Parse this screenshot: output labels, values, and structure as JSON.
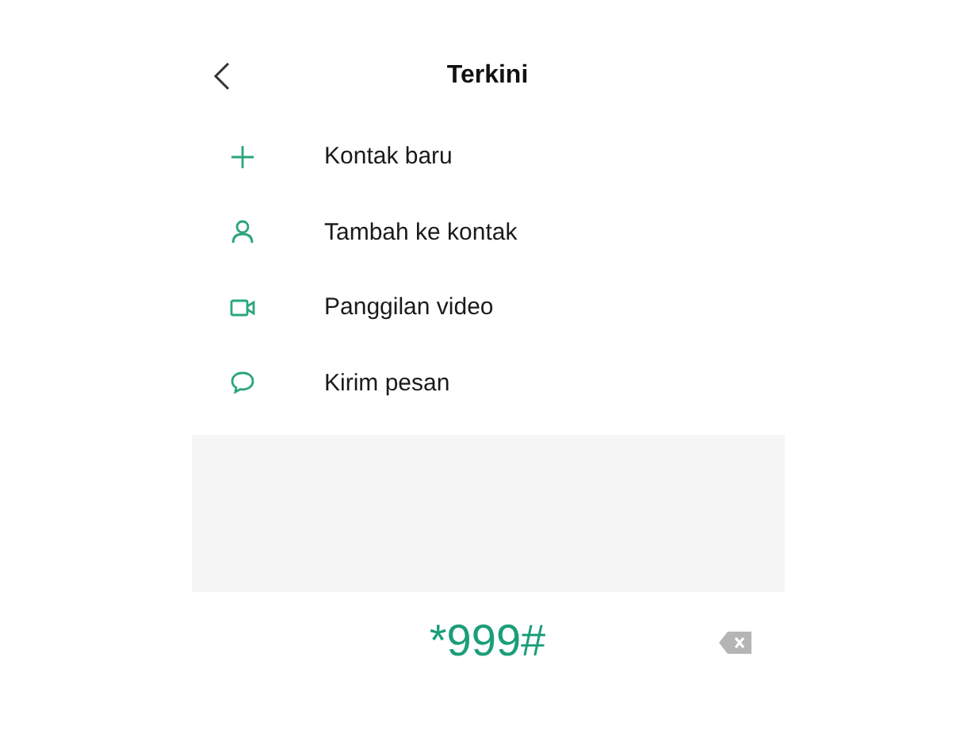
{
  "header": {
    "title": "Terkini"
  },
  "actions": [
    {
      "kind": "add",
      "label": "Kontak baru"
    },
    {
      "kind": "person",
      "label": "Tambah ke kontak"
    },
    {
      "kind": "video",
      "label": "Panggilan video"
    },
    {
      "kind": "message",
      "label": "Kirim pesan"
    }
  ],
  "dialer": {
    "number": "*999#"
  }
}
